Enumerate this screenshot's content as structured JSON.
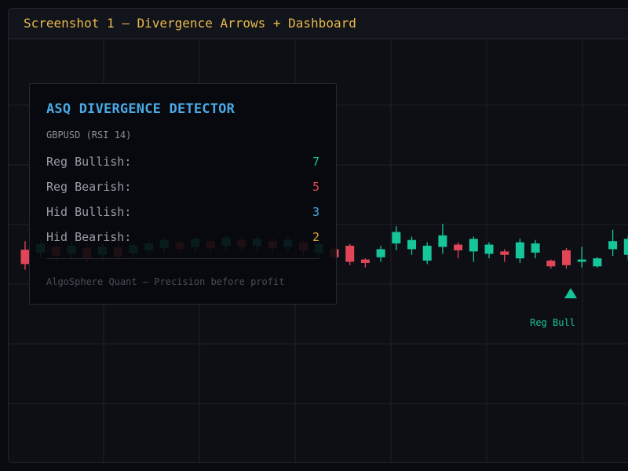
{
  "window": {
    "title": "Screenshot 1 — Divergence Arrows + Dashboard"
  },
  "dashboard": {
    "title": "ASQ DIVERGENCE DETECTOR",
    "subtitle": "GBPUSD (RSI 14)",
    "stats": [
      {
        "label": "Reg Bullish:",
        "value": "7",
        "color": "#17c59a"
      },
      {
        "label": "Reg Bearish:",
        "value": "5",
        "color": "#e04558"
      },
      {
        "label": "Hid Bullish:",
        "value": "3",
        "color": "#4aa9e6"
      },
      {
        "label": "Hid Bearish:",
        "value": "2",
        "color": "#e0a53a"
      }
    ],
    "footer": "AlgoSphere Quant — Precision before profit"
  },
  "signal": {
    "label": "Reg Bull",
    "icon": "triangle-up-icon",
    "color": "#17c59a"
  },
  "colors": {
    "bull": "#17c59a",
    "bear": "#e04558",
    "grid": "#1e212a"
  },
  "candles": [
    {
      "bull": false,
      "wt": 0.6,
      "bt": 0.45,
      "bb": 0.2,
      "wb": 0.1
    },
    {
      "bull": true,
      "wt": 0.62,
      "bt": 0.55,
      "bb": 0.4,
      "wb": 0.3
    },
    {
      "bull": false,
      "wt": 0.58,
      "bt": 0.5,
      "bb": 0.35,
      "wb": 0.25
    },
    {
      "bull": true,
      "wt": 0.6,
      "bt": 0.52,
      "bb": 0.38,
      "wb": 0.28
    },
    {
      "bull": false,
      "wt": 0.56,
      "bt": 0.48,
      "bb": 0.3,
      "wb": 0.22
    },
    {
      "bull": true,
      "wt": 0.55,
      "bt": 0.5,
      "bb": 0.36,
      "wb": 0.27
    },
    {
      "bull": false,
      "wt": 0.57,
      "bt": 0.49,
      "bb": 0.33,
      "wb": 0.24
    },
    {
      "bull": true,
      "wt": 0.59,
      "bt": 0.53,
      "bb": 0.39,
      "wb": 0.31
    },
    {
      "bull": true,
      "wt": 0.62,
      "bt": 0.56,
      "bb": 0.44,
      "wb": 0.36
    },
    {
      "bull": true,
      "wt": 0.66,
      "bt": 0.62,
      "bb": 0.48,
      "wb": 0.4
    },
    {
      "bull": false,
      "wt": 0.63,
      "bt": 0.58,
      "bb": 0.46,
      "wb": 0.38
    },
    {
      "bull": true,
      "wt": 0.68,
      "bt": 0.64,
      "bb": 0.5,
      "wb": 0.42
    },
    {
      "bull": false,
      "wt": 0.66,
      "bt": 0.6,
      "bb": 0.48,
      "wb": 0.4
    },
    {
      "bull": true,
      "wt": 0.7,
      "bt": 0.66,
      "bb": 0.52,
      "wb": 0.44
    },
    {
      "bull": false,
      "wt": 0.67,
      "bt": 0.62,
      "bb": 0.5,
      "wb": 0.41
    },
    {
      "bull": true,
      "wt": 0.69,
      "bt": 0.64,
      "bb": 0.52,
      "wb": 0.42
    },
    {
      "bull": false,
      "wt": 0.66,
      "bt": 0.6,
      "bb": 0.48,
      "wb": 0.38
    },
    {
      "bull": true,
      "wt": 0.68,
      "bt": 0.62,
      "bb": 0.5,
      "wb": 0.42
    },
    {
      "bull": false,
      "wt": 0.64,
      "bt": 0.58,
      "bb": 0.44,
      "wb": 0.36
    },
    {
      "bull": true,
      "wt": 0.62,
      "bt": 0.55,
      "bb": 0.4,
      "wb": 0.3
    },
    {
      "bull": false,
      "wt": 0.49,
      "bt": 0.46,
      "bb": 0.32,
      "wb": 0.26
    },
    {
      "bull": false,
      "wt": 0.55,
      "bt": 0.52,
      "bb": 0.24,
      "wb": 0.18
    },
    {
      "bull": false,
      "wt": 0.3,
      "bt": 0.28,
      "bb": 0.22,
      "wb": 0.14
    },
    {
      "bull": true,
      "wt": 0.52,
      "bt": 0.46,
      "bb": 0.32,
      "wb": 0.24
    },
    {
      "bull": true,
      "wt": 0.86,
      "bt": 0.76,
      "bb": 0.56,
      "wb": 0.44
    },
    {
      "bull": true,
      "wt": 0.68,
      "bt": 0.62,
      "bb": 0.46,
      "wb": 0.36
    },
    {
      "bull": true,
      "wt": 0.58,
      "bt": 0.52,
      "bb": 0.26,
      "wb": 0.2
    },
    {
      "bull": true,
      "wt": 0.9,
      "bt": 0.7,
      "bb": 0.5,
      "wb": 0.38
    },
    {
      "bull": false,
      "wt": 0.58,
      "bt": 0.54,
      "bb": 0.44,
      "wb": 0.3
    },
    {
      "bull": true,
      "wt": 0.68,
      "bt": 0.64,
      "bb": 0.42,
      "wb": 0.24
    },
    {
      "bull": true,
      "wt": 0.58,
      "bt": 0.54,
      "bb": 0.38,
      "wb": 0.3
    },
    {
      "bull": false,
      "wt": 0.46,
      "bt": 0.42,
      "bb": 0.36,
      "wb": 0.24
    },
    {
      "bull": true,
      "wt": 0.64,
      "bt": 0.58,
      "bb": 0.3,
      "wb": 0.22
    },
    {
      "bull": true,
      "wt": 0.62,
      "bt": 0.56,
      "bb": 0.4,
      "wb": 0.3
    },
    {
      "bull": false,
      "wt": 0.28,
      "bt": 0.26,
      "bb": 0.16,
      "wb": 0.12
    },
    {
      "bull": false,
      "wt": 0.48,
      "bt": 0.44,
      "bb": 0.18,
      "wb": 0.12
    },
    {
      "bull": true,
      "wt": 0.5,
      "bt": 0.28,
      "bb": 0.24,
      "wb": 0.14
    },
    {
      "bull": true,
      "wt": 0.32,
      "bt": 0.3,
      "bb": 0.16,
      "wb": 0.14
    },
    {
      "bull": true,
      "wt": 0.8,
      "bt": 0.6,
      "bb": 0.46,
      "wb": 0.34
    },
    {
      "bull": true,
      "wt": 0.7,
      "bt": 0.64,
      "bb": 0.36,
      "wb": 0.26
    }
  ]
}
